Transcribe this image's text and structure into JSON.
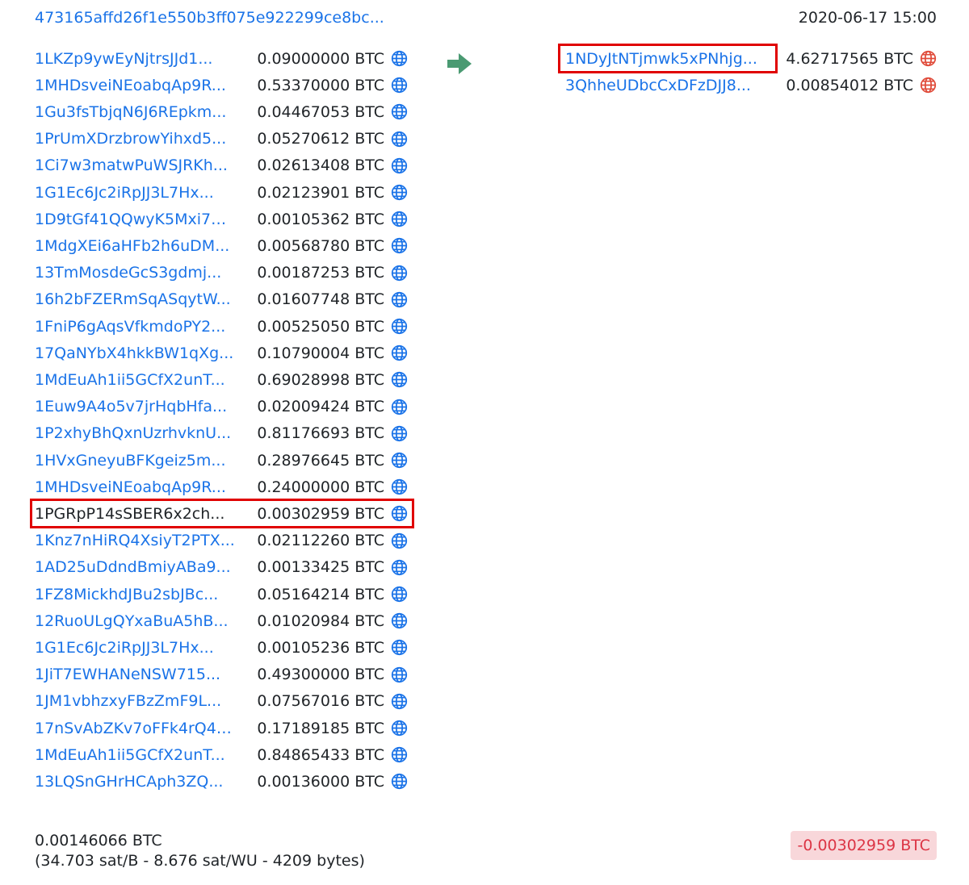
{
  "tx": {
    "id": "473165affd26f1e550b3ff075e922299ce8bc...",
    "time": "2020-06-17 15:00"
  },
  "colors": {
    "link": "#1a73e8",
    "highlight": "#e00000",
    "arrow": "#4a9a72",
    "globe_blue": "#1a73e8",
    "globe_red": "#e04b3a",
    "badge_bg": "#f8d7da",
    "badge_text": "#dc3545"
  },
  "inputs": [
    {
      "address": "1LKZp9ywEyNjtrsJJd1...",
      "amount": "0.09000000 BTC"
    },
    {
      "address": "1MHDsveiNEoabqAp9R...",
      "amount": "0.53370000 BTC"
    },
    {
      "address": "1Gu3fsTbjqN6J6REpkm...",
      "amount": "0.04467053 BTC"
    },
    {
      "address": "1PrUmXDrzbrowYihxd5...",
      "amount": "0.05270612 BTC"
    },
    {
      "address": "1Ci7w3matwPuWSJRKh...",
      "amount": "0.02613408 BTC"
    },
    {
      "address": "1G1Ec6Jc2iRpJJ3L7Hx...",
      "amount": "0.02123901 BTC"
    },
    {
      "address": "1D9tGf41QQwyK5Mxi7g...",
      "amount": "0.00105362 BTC"
    },
    {
      "address": "1MdgXEi6aHFb2h6uDM...",
      "amount": "0.00568780 BTC"
    },
    {
      "address": "13TmMosdeGcS3gdmj...",
      "amount": "0.00187253 BTC"
    },
    {
      "address": "16h2bFZERmSqASqytW...",
      "amount": "0.01607748 BTC"
    },
    {
      "address": "1FniP6gAqsVfkmdoPY2...",
      "amount": "0.00525050 BTC"
    },
    {
      "address": "17QaNYbX4hkkBW1qXg...",
      "amount": "0.10790004 BTC"
    },
    {
      "address": "1MdEuAh1ii5GCfX2unT...",
      "amount": "0.69028998 BTC"
    },
    {
      "address": "1Euw9A4o5v7jrHqbHfa...",
      "amount": "0.02009424 BTC"
    },
    {
      "address": "1P2xhyBhQxnUzrhvknU...",
      "amount": "0.81176693 BTC"
    },
    {
      "address": "1HVxGneyuBFKgeiz5m...",
      "amount": "0.28976645 BTC"
    },
    {
      "address": "1MHDsveiNEoabqAp9R...",
      "amount": "0.24000000 BTC"
    },
    {
      "address": "1PGRpP14sSBER6x2ch...",
      "amount": "0.00302959 BTC",
      "highlighted": true
    },
    {
      "address": "1Knz7nHiRQ4XsiyT2PTX...",
      "amount": "0.02112260 BTC"
    },
    {
      "address": "1AD25uDdndBmiyABa9...",
      "amount": "0.00133425 BTC"
    },
    {
      "address": "1FZ8MickhdJBu2sbJBc...",
      "amount": "0.05164214 BTC"
    },
    {
      "address": "12RuoULgQYxaBuA5hB...",
      "amount": "0.01020984 BTC"
    },
    {
      "address": "1G1Ec6Jc2iRpJJ3L7Hx...",
      "amount": "0.00105236 BTC"
    },
    {
      "address": "1JiT7EWHANeNSW715...",
      "amount": "0.49300000 BTC"
    },
    {
      "address": "1JM1vbhzxyFBzZmF9L...",
      "amount": "0.07567016 BTC"
    },
    {
      "address": "17nSvAbZKv7oFFk4rQ4z...",
      "amount": "0.17189185 BTC"
    },
    {
      "address": "1MdEuAh1ii5GCfX2unT...",
      "amount": "0.84865433 BTC"
    },
    {
      "address": "13LQSnGHrHCAph3ZQ...",
      "amount": "0.00136000 BTC"
    }
  ],
  "outputs": [
    {
      "address": "1NDyJtNTjmwk5xPNhjg...",
      "amount": "4.62717565 BTC",
      "highlighted": true
    },
    {
      "address": "3QhheUDbcCxDFzDJJ8...",
      "amount": "0.00854012 BTC"
    }
  ],
  "fee": {
    "amount": "0.00146066 BTC",
    "details": "(34.703 sat/B - 8.676 sat/WU - 4209 bytes)"
  },
  "balance_delta": "-0.00302959 BTC",
  "icons": {
    "input_icon": "globe-icon",
    "output_icon": "globe-icon",
    "flow_icon": "arrow-right-icon"
  }
}
